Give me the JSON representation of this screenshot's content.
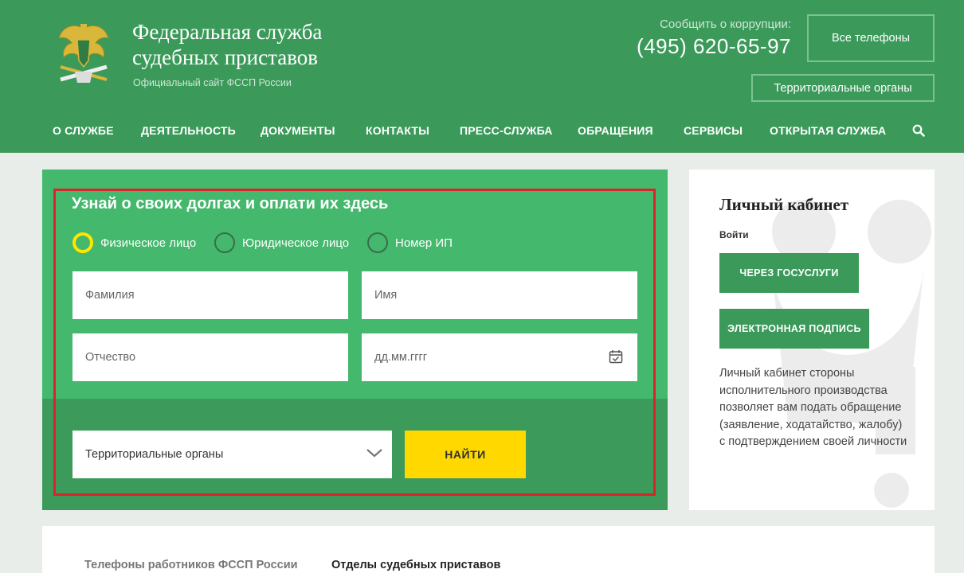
{
  "header": {
    "title_line1": "Федеральная служба",
    "title_line2": "судебных приставов",
    "subtitle": "Официальный сайт ФССП России",
    "corruption_label": "Сообщить о коррупции:",
    "corruption_phone": "(495) 620-65-97",
    "all_phones_label": "Все телефоны",
    "territorial_label": "Территориальные органы",
    "emblem_icon": "fssp-emblem-icon"
  },
  "nav": {
    "items": [
      "О СЛУЖБЕ",
      "ДЕЯТЕЛЬНОСТЬ",
      "ДОКУМЕНТЫ",
      "КОНТАКТЫ",
      "ПРЕСС-СЛУЖБА",
      "ОБРАЩЕНИЯ",
      "СЕРВИСЫ",
      "ОТКРЫТАЯ СЛУЖБА"
    ],
    "search_icon": "search-icon"
  },
  "debt_form": {
    "title": "Узнай о своих долгах и оплати их здесь",
    "radios": [
      {
        "label": "Физическое лицо",
        "selected": true
      },
      {
        "label": "Юридическое лицо",
        "selected": false
      },
      {
        "label": "Номер ИП",
        "selected": false
      }
    ],
    "lastname_placeholder": "Фамилия",
    "firstname_placeholder": "Имя",
    "patronymic_placeholder": "Отчество",
    "date_placeholder": "дд.мм.гггг",
    "region_select_value": "Территориальные органы",
    "find_label": "НАЙТИ",
    "colors": {
      "card": "#44b86c",
      "card_bottom": "#3c9b5a",
      "highlight_frame": "#d8242a",
      "find_button": "#ffd800",
      "selected_radio": "#ffe500"
    }
  },
  "cabinet": {
    "title": "Личный кабинет",
    "login_label": "Войти",
    "gosuslugi_label": "ЧЕРЕЗ ГОСУСЛУГИ",
    "ecp_label": "ЭЛЕКТРОННАЯ ПОДПИСЬ",
    "description": "Личный кабинет стороны исполнительного производства позволяет вам подать обращение (заявление, ходатайство, жалобу) с подтверждением своей личности"
  },
  "bottom": {
    "tab1_label": "Телефоны работников ФССП России",
    "tab2_label": "Отделы судебных приставов"
  },
  "colors": {
    "header_green": "#3b9a5a",
    "page_bg": "#e9edea"
  }
}
